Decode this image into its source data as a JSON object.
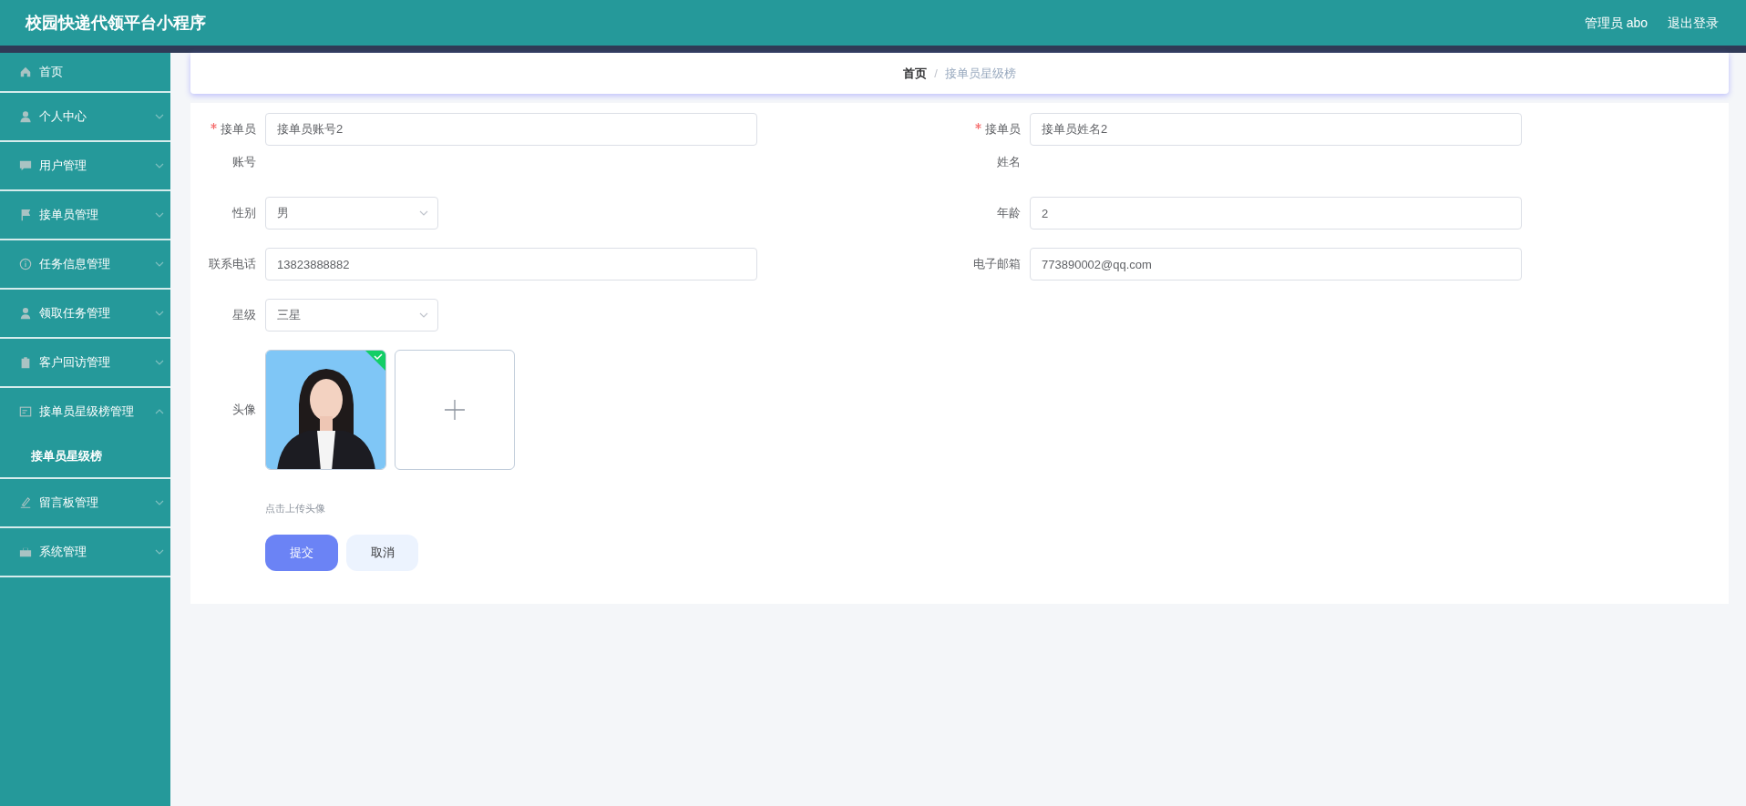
{
  "header": {
    "title": "校园快递代领平台小程序",
    "user": "管理员 abo",
    "logout": "退出登录"
  },
  "sidebar": {
    "items": [
      {
        "label": "首页",
        "kind": "link"
      },
      {
        "label": "个人中心",
        "kind": "group",
        "expanded": false
      },
      {
        "label": "用户管理",
        "kind": "group",
        "expanded": false
      },
      {
        "label": "接单员管理",
        "kind": "group",
        "expanded": false
      },
      {
        "label": "任务信息管理",
        "kind": "group",
        "expanded": false
      },
      {
        "label": "领取任务管理",
        "kind": "group",
        "expanded": false
      },
      {
        "label": "客户回访管理",
        "kind": "group",
        "expanded": false
      },
      {
        "label": "接单员星级榜管理",
        "kind": "group",
        "expanded": true,
        "children": [
          {
            "label": "接单员星级榜",
            "selected": true
          }
        ]
      },
      {
        "label": "留言板管理",
        "kind": "group",
        "expanded": false
      },
      {
        "label": "系统管理",
        "kind": "group",
        "expanded": false
      }
    ]
  },
  "breadcrumb": {
    "separator": "/",
    "items": [
      {
        "label": "首页",
        "selected": false
      },
      {
        "label": "接单员星级榜",
        "selected": true
      }
    ]
  },
  "form": {
    "rows": [
      [
        {
          "label": "接单员账号",
          "required": true,
          "kind": "text",
          "value": "接单员账号2"
        },
        {
          "label": "接单员姓名",
          "required": true,
          "kind": "text",
          "value": "接单员姓名2"
        }
      ],
      [
        {
          "label": "性别",
          "required": false,
          "kind": "select",
          "value": "男"
        },
        {
          "label": "年龄",
          "required": false,
          "kind": "text",
          "value": "2"
        }
      ],
      [
        {
          "label": "联系电话",
          "required": false,
          "kind": "text",
          "value": "13823888882"
        },
        {
          "label": "电子邮箱",
          "required": false,
          "kind": "text",
          "value": "773890002@qq.com"
        }
      ],
      [
        {
          "label": "星级",
          "required": false,
          "kind": "select",
          "value": "三星"
        }
      ],
      [
        {
          "label": "头像",
          "required": false,
          "kind": "upload",
          "uploaded": true,
          "hint": "点击上传头像"
        }
      ]
    ],
    "buttons": [
      {
        "label": "提交",
        "kind": "primary"
      },
      {
        "label": "取消",
        "kind": "secondary"
      }
    ]
  }
}
